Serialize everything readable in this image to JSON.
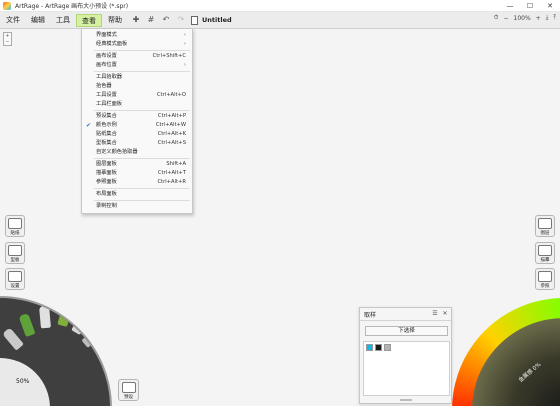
{
  "window": {
    "title": "ArtRage - ArtRage 画布大小预设 (*.spr)",
    "minimize": "—",
    "maximize": "☐",
    "close": "✕"
  },
  "menubar": {
    "items": [
      "文件",
      "编辑",
      "工具",
      "查看",
      "帮助"
    ],
    "active_index": 3,
    "doc_title": "Untitled",
    "zoom": "100%"
  },
  "view_menu": {
    "items": [
      {
        "label": "界面模式",
        "shortcut": "",
        "submenu": true
      },
      {
        "label": "经典模式面板",
        "shortcut": "",
        "submenu": true
      },
      {
        "sep": true
      },
      {
        "label": "画布设置",
        "shortcut": "Ctrl+Shift+C"
      },
      {
        "label": "画布位置",
        "shortcut": "",
        "submenu": true
      },
      {
        "sep": true
      },
      {
        "label": "工具拾取器",
        "shortcut": ""
      },
      {
        "label": "拾色器",
        "shortcut": ""
      },
      {
        "label": "工具设置",
        "shortcut": "Ctrl+Alt+O"
      },
      {
        "label": "工具栏面板",
        "shortcut": ""
      },
      {
        "sep": true
      },
      {
        "label": "预设集合",
        "shortcut": "Ctrl+Alt+P"
      },
      {
        "label": "颜色示例",
        "shortcut": "Ctrl+Alt+W",
        "checked": true
      },
      {
        "label": "贴纸集合",
        "shortcut": "Ctrl+Alt+K"
      },
      {
        "label": "型板集合",
        "shortcut": "Ctrl+Alt+S"
      },
      {
        "label": "自定义颜色拾取器",
        "shortcut": ""
      },
      {
        "sep": true
      },
      {
        "label": "图层面板",
        "shortcut": "Shift+A"
      },
      {
        "label": "描摹面板",
        "shortcut": "Ctrl+Alt+T"
      },
      {
        "label": "参照面板",
        "shortcut": "Ctrl+Alt+R"
      },
      {
        "sep": true
      },
      {
        "label": "布局面板",
        "shortcut": ""
      },
      {
        "sep": true
      },
      {
        "label": "录制控制",
        "shortcut": ""
      }
    ]
  },
  "left_pods": {
    "stickers": "贴纸",
    "stencils": "型板",
    "settings": "设置",
    "presets": "预设"
  },
  "tool_wheel": {
    "zoom": "50%"
  },
  "sampler": {
    "title": "取样",
    "next_button": "下选择",
    "swatch_colors": [
      "#18b6e6",
      "#1a1a1a",
      "#b3b3b3"
    ]
  },
  "color_picker": {
    "label": "金属感 0%"
  },
  "right_pods": {
    "layers": "图层",
    "tracing": "描摹",
    "reference": "参照"
  },
  "colors": {
    "accent": "#d7f1a3",
    "check": "#2a7fd4"
  }
}
